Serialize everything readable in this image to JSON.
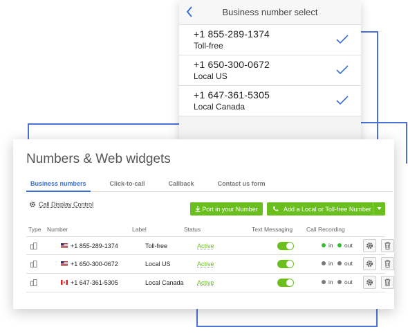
{
  "mobile": {
    "title": "Business number select",
    "items": [
      {
        "number": "+1 855-289-1374",
        "label": "Toll-free"
      },
      {
        "number": "+1 650-300-0672",
        "label": "Local US"
      },
      {
        "number": "+1 647-361-5305",
        "label": "Local Canada"
      }
    ]
  },
  "panel": {
    "title": "Numbers & Web widgets",
    "tabs": [
      {
        "label": "Business numbers",
        "active": true
      },
      {
        "label": "Click-to-call",
        "active": false
      },
      {
        "label": "Callback",
        "active": false
      },
      {
        "label": "Contact us form",
        "active": false
      }
    ],
    "call_display_control": "Call Display Control",
    "buttons": {
      "port": "Port in your Number",
      "add": "Add a Local or Toll-free Number"
    },
    "columns": {
      "type": "Type",
      "number": "Number",
      "label": "Label",
      "status": "Status",
      "text": "Text Messaging",
      "recording": "Call Recording"
    },
    "rows": [
      {
        "flag": "us",
        "number": "+1 855-289-1374",
        "label": "Toll-free",
        "status": "Active",
        "in": "in",
        "out": "out",
        "in_color": "#33bb33",
        "out_color": "#33bb33"
      },
      {
        "flag": "us",
        "number": "+1 650-300-0672",
        "label": "Local US",
        "status": "Active",
        "in": "in",
        "out": "out",
        "in_color": "#777777",
        "out_color": "#777777"
      },
      {
        "flag": "ca",
        "number": "+1 647-361-5305",
        "label": "Local Canada",
        "status": "Active",
        "in": "in",
        "out": "out",
        "in_color": "#777777",
        "out_color": "#777777"
      }
    ]
  },
  "colors": {
    "accent": "#3a6fd8",
    "green": "#6abf1f",
    "connector": "#4a72d9"
  }
}
